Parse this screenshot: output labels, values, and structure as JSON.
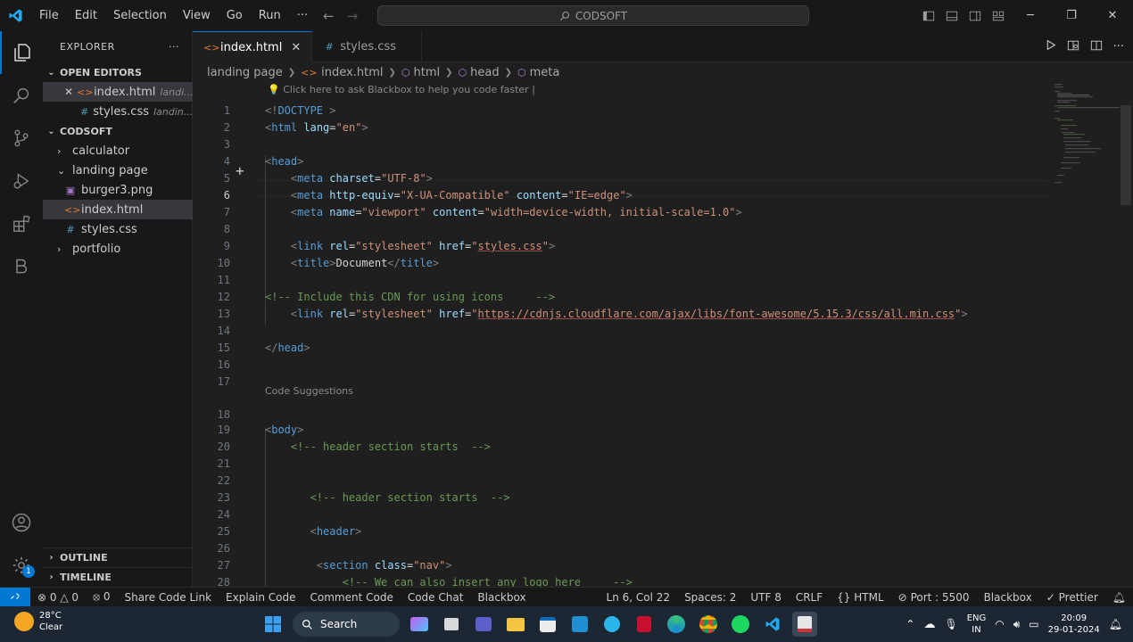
{
  "titlebar": {
    "menu": [
      "File",
      "Edit",
      "Selection",
      "View",
      "Go",
      "Run",
      "···"
    ],
    "search_text": "CODSOFT"
  },
  "explorer": {
    "title": "EXPLORER",
    "more": "···",
    "open_editors_label": "OPEN EDITORS",
    "open_editors": [
      {
        "name": "index.html",
        "desc": "landi...",
        "icon": "html-file-icon"
      },
      {
        "name": "styles.css",
        "desc": "landin...",
        "icon": "css-file-icon"
      }
    ],
    "workspace_label": "CODSOFT",
    "tree": [
      {
        "name": "calculator",
        "type": "folder"
      },
      {
        "name": "landing page",
        "type": "folder-open"
      },
      {
        "name": "burger3.png",
        "type": "png"
      },
      {
        "name": "index.html",
        "type": "html"
      },
      {
        "name": "styles.css",
        "type": "css"
      },
      {
        "name": "portfolio",
        "type": "folder"
      }
    ],
    "outline_label": "OUTLINE",
    "timeline_label": "TIMELINE"
  },
  "tabs": [
    {
      "label": "index.html",
      "icon": "html-file-icon",
      "active": true,
      "close": "✕"
    },
    {
      "label": "styles.css",
      "icon": "css-file-icon",
      "active": false
    }
  ],
  "breadcrumbs": [
    "landing page",
    "index.html",
    "html",
    "head",
    "meta"
  ],
  "editor": {
    "hint": "Click here to ask Blackbox to help you code faster |",
    "code_suggestions": "Code Suggestions",
    "current_line": 6,
    "lines": [
      {
        "n": "1",
        "c": "<!DOCTYPE html>"
      },
      {
        "n": "2",
        "c": "<html lang=\"en\">"
      },
      {
        "n": "3",
        "c": ""
      },
      {
        "n": "4",
        "c": "<head>"
      },
      {
        "n": "5",
        "c": "    <meta charset=\"UTF-8\">"
      },
      {
        "n": "6",
        "c": "    <meta http-equiv=\"X-UA-Compatible\" content=\"IE=edge\">"
      },
      {
        "n": "7",
        "c": "    <meta name=\"viewport\" content=\"width=device-width, initial-scale=1.0\">"
      },
      {
        "n": "8",
        "c": ""
      },
      {
        "n": "9",
        "c": "    <link rel=\"stylesheet\" href=\"styles.css\">"
      },
      {
        "n": "10",
        "c": "    <title>Document</title>"
      },
      {
        "n": "11",
        "c": ""
      },
      {
        "n": "12",
        "c": "<!-- Include this CDN for using icons     -->"
      },
      {
        "n": "13",
        "c": "    <link rel=\"stylesheet\" href=\"https://cdnjs.cloudflare.com/ajax/libs/font-awesome/5.15.3/css/all.min.css\">"
      },
      {
        "n": "14",
        "c": ""
      },
      {
        "n": "15",
        "c": "</head>"
      },
      {
        "n": "16",
        "c": ""
      },
      {
        "n": "17",
        "c": ""
      },
      {
        "n": "18",
        "c": ""
      },
      {
        "n": "19",
        "c": "<body>"
      },
      {
        "n": "20",
        "c": "    <!-- header section starts  -->"
      },
      {
        "n": "21",
        "c": ""
      },
      {
        "n": "22",
        "c": ""
      },
      {
        "n": "23",
        "c": "       <!-- header section starts  -->"
      },
      {
        "n": "24",
        "c": ""
      },
      {
        "n": "25",
        "c": "       <header>"
      },
      {
        "n": "26",
        "c": ""
      },
      {
        "n": "27",
        "c": "        <section class=\"nav\">"
      },
      {
        "n": "28",
        "c": "            <!-- We can also insert any logo here     -->"
      }
    ]
  },
  "statusbar": {
    "errors": "0",
    "warnings": "0",
    "ports": "0",
    "left_items": [
      "Share Code Link",
      "Explain Code",
      "Comment Code",
      "Code Chat",
      "Blackbox"
    ],
    "position": "Ln 6, Col 22",
    "spaces": "Spaces: 2",
    "encoding": "UTF 8",
    "eol": "CRLF",
    "language": "HTML",
    "port": "Port : 5500",
    "blackbox": "Blackbox",
    "prettier": "Prettier"
  },
  "taskbar": {
    "temp": "28°C",
    "weather": "Clear",
    "search": "Search",
    "lang": "ENG",
    "region": "IN",
    "time": "20:09",
    "date": "29-01-2024"
  },
  "colors": {
    "accent": "#0078d4",
    "html_icon": "#e37933",
    "css_icon": "#519aba"
  }
}
